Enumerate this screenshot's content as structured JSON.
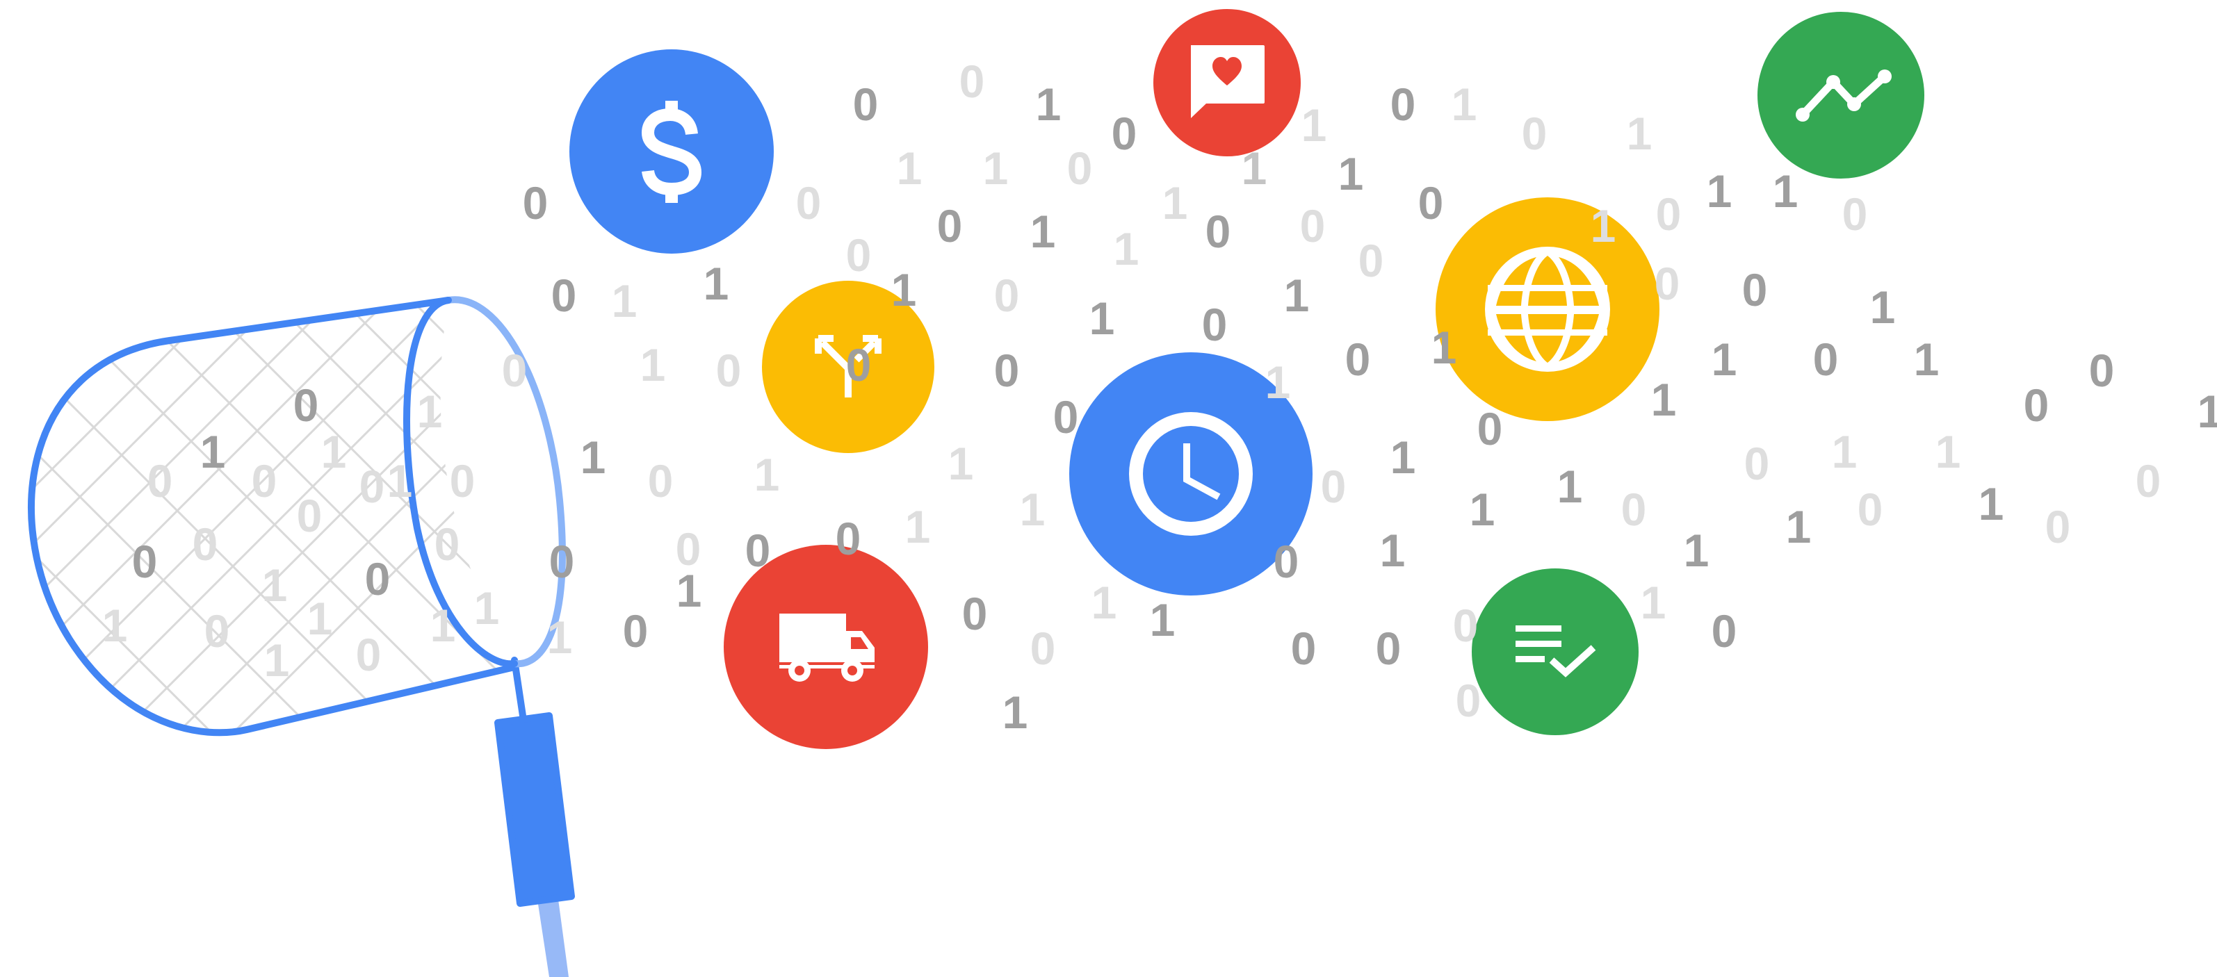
{
  "illustration": {
    "binary_digits": {
      "glyph_zero": "0",
      "glyph_one": "1",
      "color_dark": "#9e9e9e",
      "color_mid": "#c4c4c4",
      "color_light": "#dedede"
    },
    "badges": [
      {
        "name": "dollar-badge",
        "icon": "dollar-icon",
        "color": "#4285f4"
      },
      {
        "name": "chat-heart-badge",
        "icon": "chat-heart-icon",
        "color": "#ea4335"
      },
      {
        "name": "trend-line-badge",
        "icon": "trend-line-icon",
        "color": "#34a853"
      },
      {
        "name": "split-arrows-badge",
        "icon": "split-arrows-icon",
        "color": "#fbbc04"
      },
      {
        "name": "clock-badge",
        "icon": "clock-icon",
        "color": "#4285f4"
      },
      {
        "name": "globe-badge",
        "icon": "globe-icon",
        "color": "#fbbc04"
      },
      {
        "name": "delivery-truck-badge",
        "icon": "delivery-truck-icon",
        "color": "#ea4335"
      },
      {
        "name": "checklist-badge",
        "icon": "checklist-icon",
        "color": "#34a853"
      }
    ],
    "net": {
      "icon": "butterfly-net-icon",
      "rim_color": "#4285f4",
      "handle_color": "#4285f4",
      "mesh_color": "#d9d9d9"
    }
  }
}
